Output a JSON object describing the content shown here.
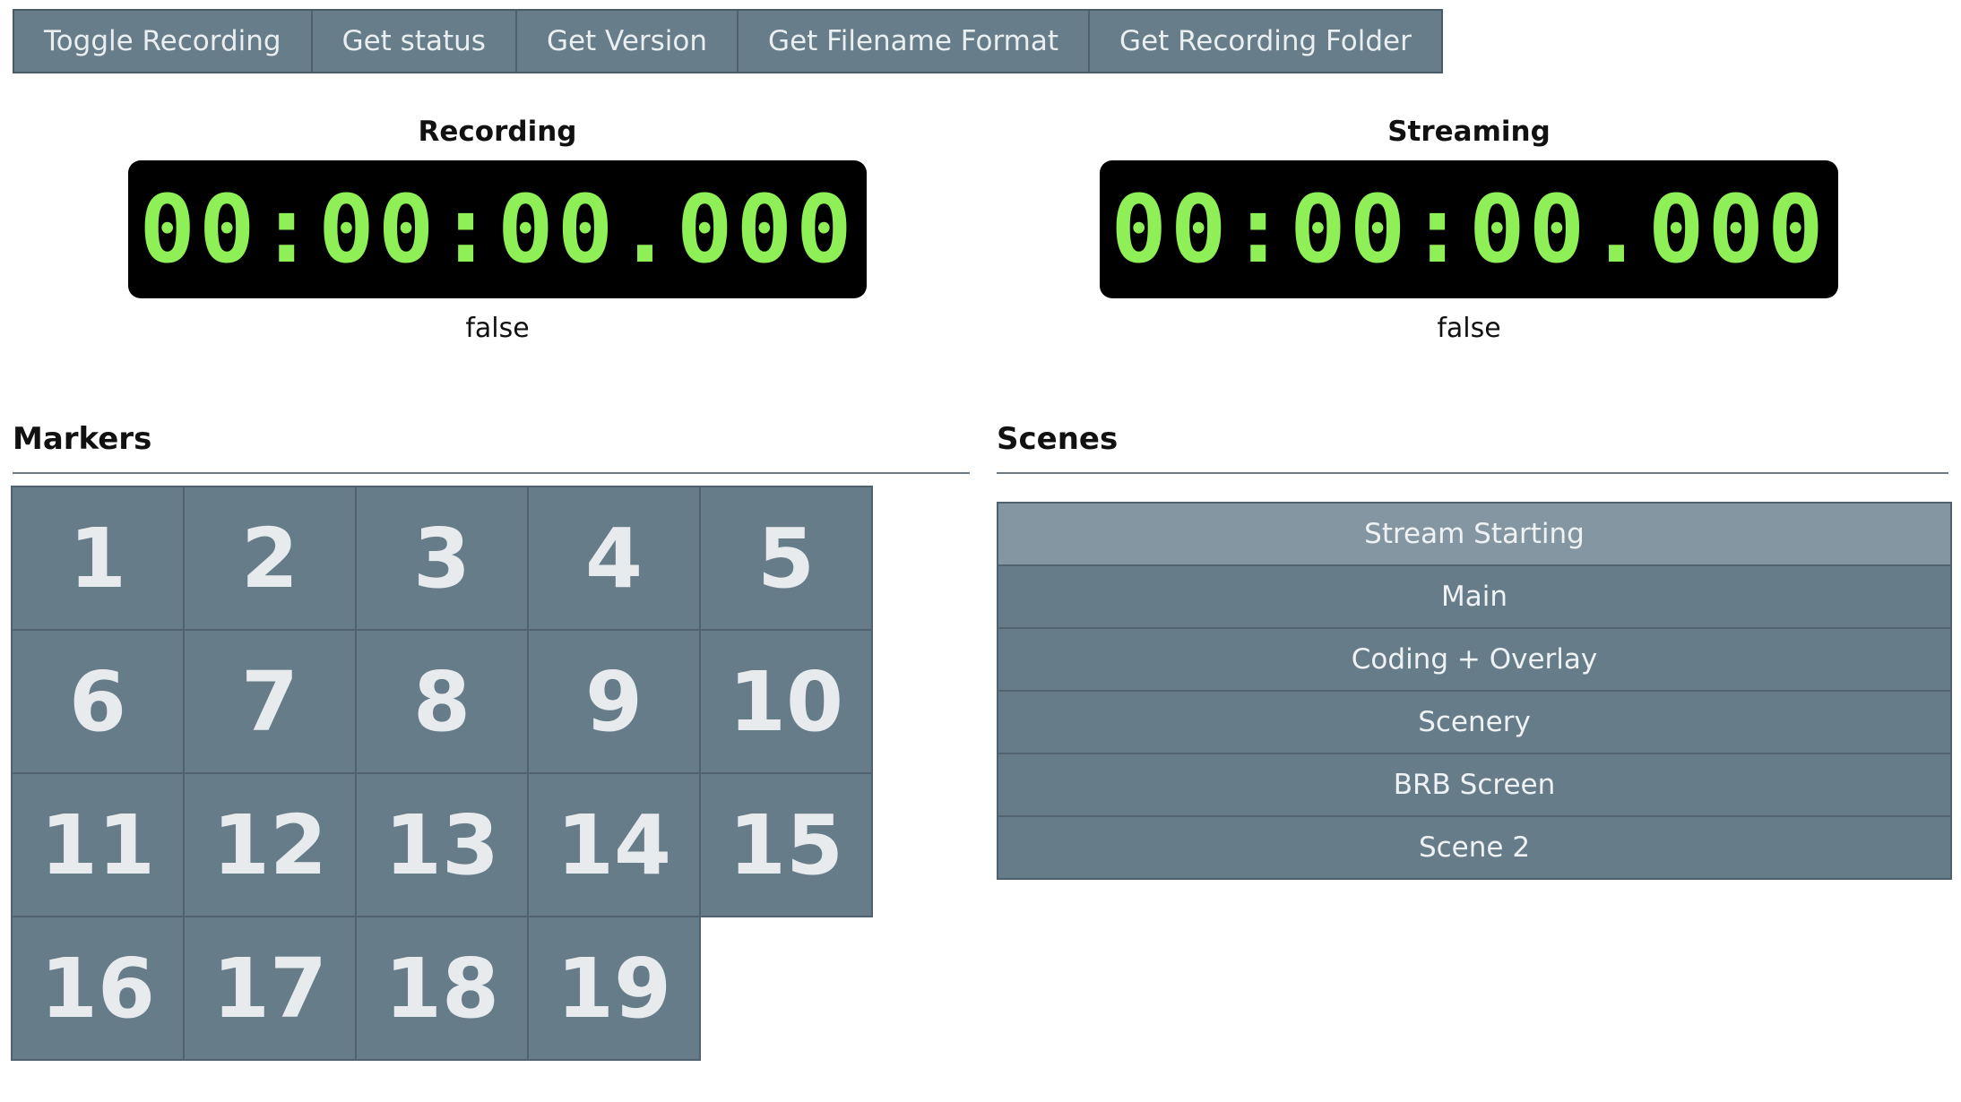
{
  "toolbar": {
    "buttons": [
      "Toggle Recording",
      "Get status",
      "Get Version",
      "Get Filename Format",
      "Get Recording Folder"
    ]
  },
  "recording": {
    "title": "Recording",
    "time": "00:00:00.000",
    "status": "false"
  },
  "streaming": {
    "title": "Streaming",
    "time": "00:00:00.000",
    "status": "false"
  },
  "markers": {
    "title": "Markers",
    "items": [
      "1",
      "2",
      "3",
      "4",
      "5",
      "6",
      "7",
      "8",
      "9",
      "10",
      "11",
      "12",
      "13",
      "14",
      "15",
      "16",
      "17",
      "18",
      "19"
    ]
  },
  "scenes": {
    "title": "Scenes",
    "items": [
      "Stream Starting",
      "Main",
      "Coding + Overlay",
      "Scenery",
      "BRB Screen",
      "Scene 2"
    ],
    "active_index": 0
  },
  "colors": {
    "button_bg": "#667c89",
    "active_scene_bg": "#8496a1",
    "timer_bg": "#000000",
    "timer_digits": "#8fef56"
  }
}
